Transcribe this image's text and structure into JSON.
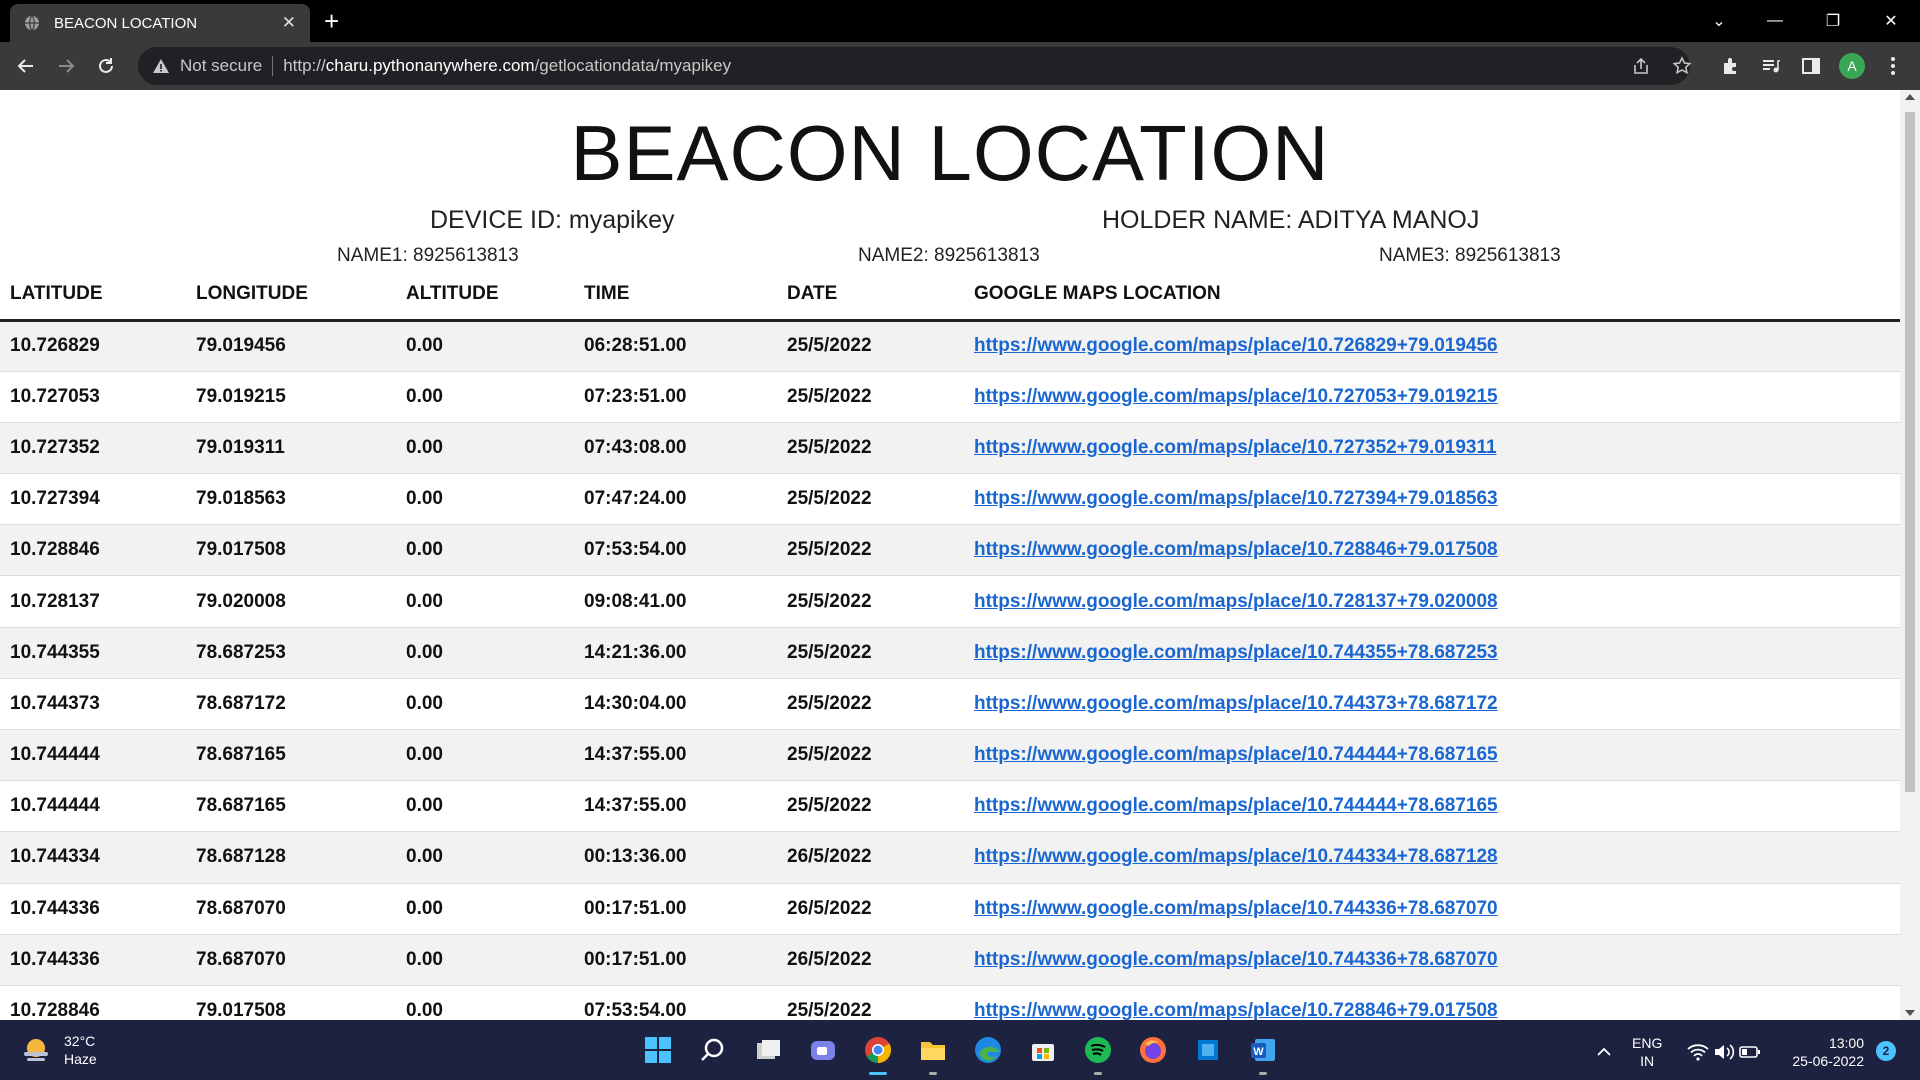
{
  "browser": {
    "tab_title": "BEACON LOCATION",
    "not_secure": "Not secure",
    "url_scheme": "http://",
    "url_host": "charu.pythonanywhere.com",
    "url_path": "/getlocationdata/myapikey",
    "profile_initial": "A"
  },
  "page": {
    "title": "BEACON LOCATION",
    "device_id": "DEVICE ID: myapikey",
    "holder": "HOLDER NAME: ADITYA MANOJ",
    "name1": "NAME1: 8925613813",
    "name2": "NAME2: 8925613813",
    "name3": "NAME3: 8925613813"
  },
  "table": {
    "headers": [
      "LATITUDE",
      "LONGITUDE",
      "ALTITUDE",
      "TIME",
      "DATE",
      "GOOGLE MAPS LOCATION"
    ],
    "rows": [
      [
        "10.726829",
        "79.019456",
        "0.00",
        "06:28:51.00",
        "25/5/2022",
        "https://www.google.com/maps/place/10.726829+79.019456"
      ],
      [
        "10.727053",
        "79.019215",
        "0.00",
        "07:23:51.00",
        "25/5/2022",
        "https://www.google.com/maps/place/10.727053+79.019215"
      ],
      [
        "10.727352",
        "79.019311",
        "0.00",
        "07:43:08.00",
        "25/5/2022",
        "https://www.google.com/maps/place/10.727352+79.019311"
      ],
      [
        "10.727394",
        "79.018563",
        "0.00",
        "07:47:24.00",
        "25/5/2022",
        "https://www.google.com/maps/place/10.727394+79.018563"
      ],
      [
        "10.728846",
        "79.017508",
        "0.00",
        "07:53:54.00",
        "25/5/2022",
        "https://www.google.com/maps/place/10.728846+79.017508"
      ],
      [
        "10.728137",
        "79.020008",
        "0.00",
        "09:08:41.00",
        "25/5/2022",
        "https://www.google.com/maps/place/10.728137+79.020008"
      ],
      [
        "10.744355",
        "78.687253",
        "0.00",
        "14:21:36.00",
        "25/5/2022",
        "https://www.google.com/maps/place/10.744355+78.687253"
      ],
      [
        "10.744373",
        "78.687172",
        "0.00",
        "14:30:04.00",
        "25/5/2022",
        "https://www.google.com/maps/place/10.744373+78.687172"
      ],
      [
        "10.744444",
        "78.687165",
        "0.00",
        "14:37:55.00",
        "25/5/2022",
        "https://www.google.com/maps/place/10.744444+78.687165"
      ],
      [
        "10.744444",
        "78.687165",
        "0.00",
        "14:37:55.00",
        "25/5/2022",
        "https://www.google.com/maps/place/10.744444+78.687165"
      ],
      [
        "10.744334",
        "78.687128",
        "0.00",
        "00:13:36.00",
        "26/5/2022",
        "https://www.google.com/maps/place/10.744334+78.687128"
      ],
      [
        "10.744336",
        "78.687070",
        "0.00",
        "00:17:51.00",
        "26/5/2022",
        "https://www.google.com/maps/place/10.744336+78.687070"
      ],
      [
        "10.744336",
        "78.687070",
        "0.00",
        "00:17:51.00",
        "26/5/2022",
        "https://www.google.com/maps/place/10.744336+78.687070"
      ],
      [
        "10.728846",
        "79.017508",
        "0.00",
        "07:53:54.00",
        "25/5/2022",
        "https://www.google.com/maps/place/10.728846+79.017508"
      ]
    ]
  },
  "taskbar": {
    "temperature": "32°C",
    "weather": "Haze",
    "lang_top": "ENG",
    "lang_bottom": "IN",
    "time": "13:00",
    "date": "25-06-2022",
    "notifications": "2",
    "apps": [
      "start-icon",
      "search-icon",
      "task-view-icon",
      "teams-chat-icon",
      "chrome-icon",
      "file-explorer-icon",
      "edge-icon",
      "store-icon",
      "spotify-icon",
      "firefox-icon",
      "windows-app-icon",
      "word-icon"
    ]
  },
  "colors": {
    "link": "#1a66d1",
    "row_alt": "#f2f2f2",
    "taskbar": "#1c2240",
    "chrome_toolbar": "#3a3a3a"
  }
}
